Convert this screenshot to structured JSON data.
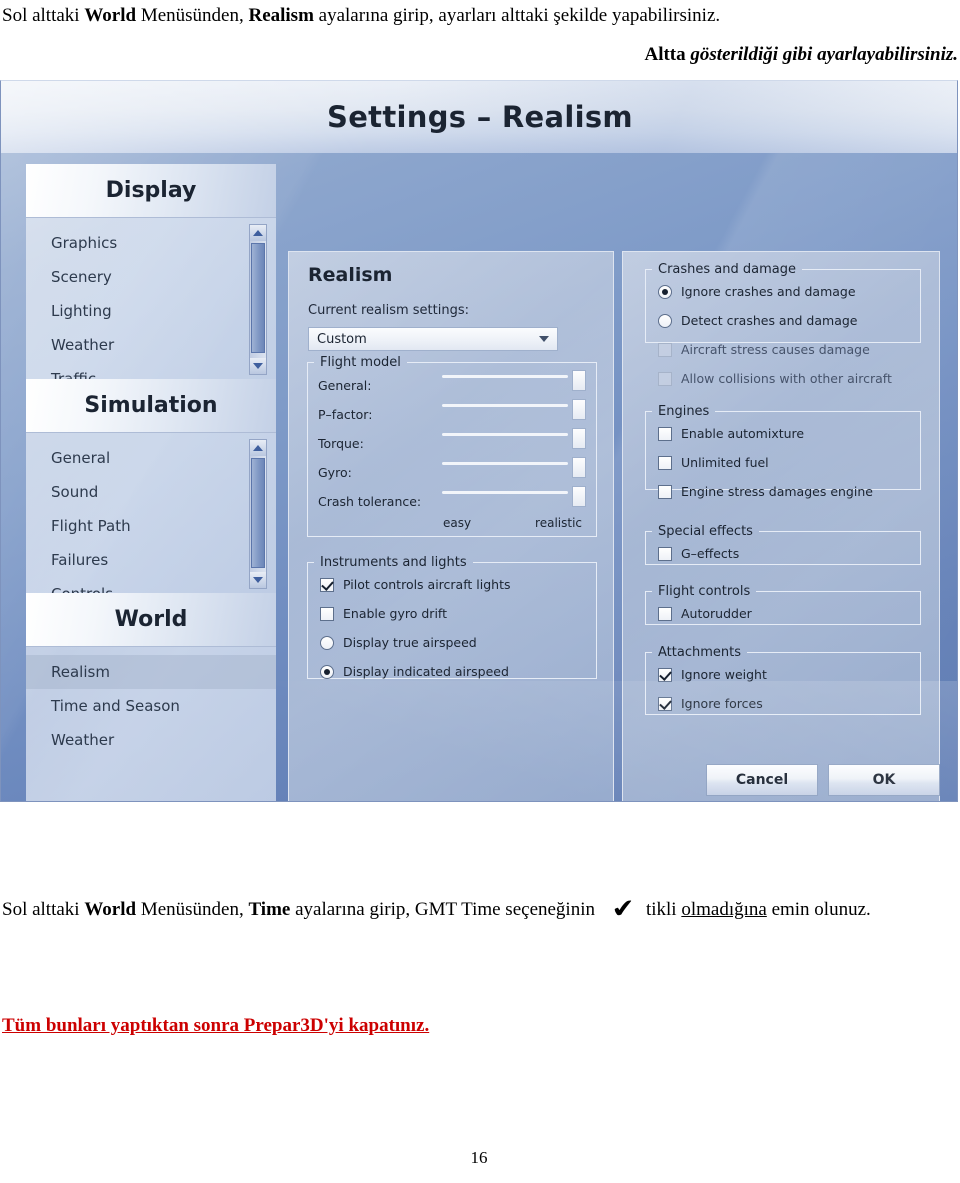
{
  "document": {
    "intro_line_parts": [
      "Sol alttaki ",
      "World",
      " Menüsünden, ",
      "Realism",
      " ayalarına girip, ayarları alttaki şekilde yapabilirsiniz."
    ],
    "intro_line_plain": "Sol alttaki World Menüsünden, Realism ayalarına girip, ayarları alttaki şekilde yapabilirsiniz.",
    "intro_right_bold": "Altta",
    "intro_right_italic": "gösterildiği gibi ayarlayabilirsiniz.",
    "bottom_part1": "Sol alttaki ",
    "bottom_bold1": "World",
    "bottom_part2": " Menüsünden, ",
    "bottom_bold2": "Time",
    "bottom_part3": " ayalarına girip, GMT Time seçeneğinin",
    "check_glyph": "✔",
    "bottom_part4": "tikli ",
    "bottom_underline": "olmadığına",
    "bottom_part5": " emin olunuz.",
    "red_note": "Tüm bunları yaptıktan sonra Prepar3D'yi kapatınız.",
    "page_number": "16"
  },
  "dialog": {
    "title": "Settings – Realism",
    "buttons": {
      "cancel": "Cancel",
      "ok": "OK"
    }
  },
  "sidebar": {
    "groups": [
      {
        "header": "Display",
        "items": [
          {
            "label": "Graphics",
            "selected": false
          },
          {
            "label": "Scenery",
            "selected": false
          },
          {
            "label": "Lighting",
            "selected": false
          },
          {
            "label": "Weather",
            "selected": false
          },
          {
            "label": "Traffic",
            "selected": false
          }
        ]
      },
      {
        "header": "Simulation",
        "items": [
          {
            "label": "General",
            "selected": false
          },
          {
            "label": "Sound",
            "selected": false
          },
          {
            "label": "Flight Path",
            "selected": false
          },
          {
            "label": "Failures",
            "selected": false
          },
          {
            "label": "Controls",
            "selected": false
          }
        ]
      },
      {
        "header": "World",
        "items": [
          {
            "label": "Realism",
            "selected": true
          },
          {
            "label": "Time and Season",
            "selected": false
          },
          {
            "label": "Weather",
            "selected": false
          }
        ]
      }
    ]
  },
  "middle_panel": {
    "title": "Realism",
    "current_settings_label": "Current realism settings:",
    "preset_value": "Custom",
    "flight_model": {
      "legend": "Flight model",
      "sliders": [
        {
          "label": "General:",
          "value": 100
        },
        {
          "label": "P–factor:",
          "value": 100
        },
        {
          "label": "Torque:",
          "value": 100
        },
        {
          "label": "Gyro:",
          "value": 100
        },
        {
          "label": "Crash tolerance:",
          "value": 100
        }
      ],
      "scale_min_label": "easy",
      "scale_max_label": "realistic"
    },
    "instruments": {
      "legend": "Instruments and lights",
      "options": [
        {
          "type": "checkbox",
          "label": "Pilot controls aircraft lights",
          "checked": true,
          "disabled": false
        },
        {
          "type": "checkbox",
          "label": "Enable gyro drift",
          "checked": false,
          "disabled": false
        },
        {
          "type": "radio",
          "label": "Display true airspeed",
          "checked": false,
          "disabled": false
        },
        {
          "type": "radio",
          "label": "Display indicated airspeed",
          "checked": true,
          "disabled": false
        }
      ]
    }
  },
  "right_panel": {
    "groups": [
      {
        "legend": "Crashes and damage",
        "options": [
          {
            "type": "radio",
            "label": "Ignore crashes and damage",
            "checked": true,
            "disabled": false
          },
          {
            "type": "radio",
            "label": "Detect crashes and damage",
            "checked": false,
            "disabled": false
          },
          {
            "type": "checkbox",
            "label": "Aircraft stress causes damage",
            "checked": false,
            "disabled": true
          },
          {
            "type": "checkbox",
            "label": "Allow collisions with other aircraft",
            "checked": false,
            "disabled": true
          }
        ]
      },
      {
        "legend": "Engines",
        "options": [
          {
            "type": "checkbox",
            "label": "Enable automixture",
            "checked": false,
            "disabled": false
          },
          {
            "type": "checkbox",
            "label": "Unlimited fuel",
            "checked": false,
            "disabled": false
          },
          {
            "type": "checkbox",
            "label": "Engine stress damages engine",
            "checked": false,
            "disabled": false
          }
        ]
      },
      {
        "legend": "Special effects",
        "options": [
          {
            "type": "checkbox",
            "label": "G–effects",
            "checked": false,
            "disabled": false
          }
        ]
      },
      {
        "legend": "Flight controls",
        "options": [
          {
            "type": "checkbox",
            "label": "Autorudder",
            "checked": false,
            "disabled": false
          }
        ]
      },
      {
        "legend": "Attachments",
        "options": [
          {
            "type": "checkbox",
            "label": "Ignore weight",
            "checked": true,
            "disabled": false
          },
          {
            "type": "checkbox",
            "label": "Ignore forces",
            "checked": true,
            "disabled": false
          }
        ]
      }
    ]
  },
  "colors": {
    "dialog_blue": "#8da6cd",
    "panel_blue": "#a4b6d4",
    "text_dark": "#1b2432",
    "red_note": "#cc0000"
  }
}
